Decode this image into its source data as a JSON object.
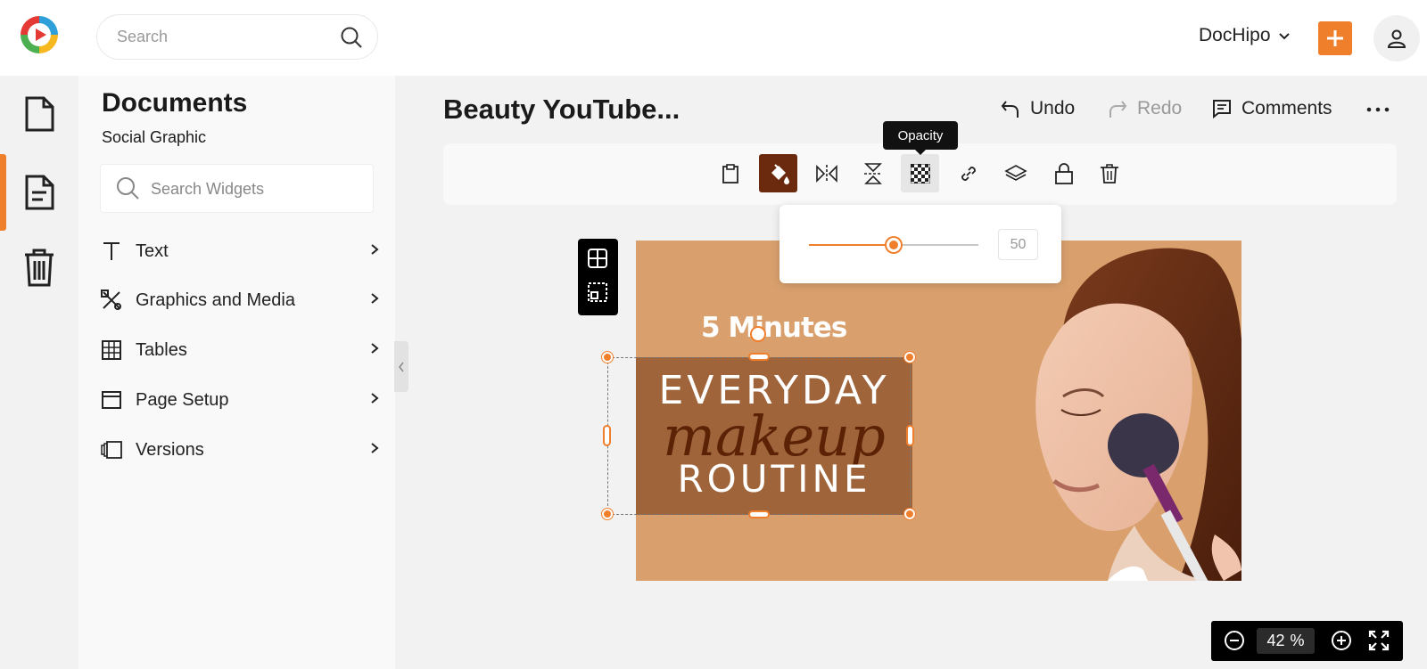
{
  "topbar": {
    "search_placeholder": "Search",
    "brand_name": "DocHipo",
    "accent_color": "#f07f2c"
  },
  "rail": {
    "items": [
      {
        "name": "documents-icon",
        "active": false
      },
      {
        "name": "templates-icon",
        "active": true
      },
      {
        "name": "trash-icon",
        "active": false
      }
    ]
  },
  "panel": {
    "title": "Documents",
    "subtitle": "Social Graphic",
    "search_placeholder": "Search Widgets",
    "items": [
      {
        "label": "Text",
        "icon": "text-icon"
      },
      {
        "label": "Graphics and Media",
        "icon": "graphics-icon"
      },
      {
        "label": "Tables",
        "icon": "table-icon"
      },
      {
        "label": "Page Setup",
        "icon": "page-setup-icon"
      },
      {
        "label": "Versions",
        "icon": "versions-icon"
      }
    ]
  },
  "header": {
    "doc_title": "Beauty YouTube...",
    "undo_label": "Undo",
    "redo_label": "Redo",
    "comments_label": "Comments"
  },
  "toolbar": {
    "tooltip": "Opacity",
    "buttons": [
      "clipboard-icon",
      "fill-color-icon",
      "flip-horizontal-icon",
      "flip-vertical-icon",
      "opacity-icon",
      "link-icon",
      "layers-icon",
      "lock-icon",
      "delete-icon"
    ]
  },
  "opacity": {
    "value": "50",
    "percent": 50
  },
  "canvas": {
    "subtitle": "5 Minutes",
    "line1": "EVERYDAY",
    "line2": "makeup",
    "line3": "ROUTINE",
    "bg_color": "#d9a06d",
    "box_color": "#a0643a"
  },
  "zoom": {
    "value": "42",
    "unit": "%"
  }
}
